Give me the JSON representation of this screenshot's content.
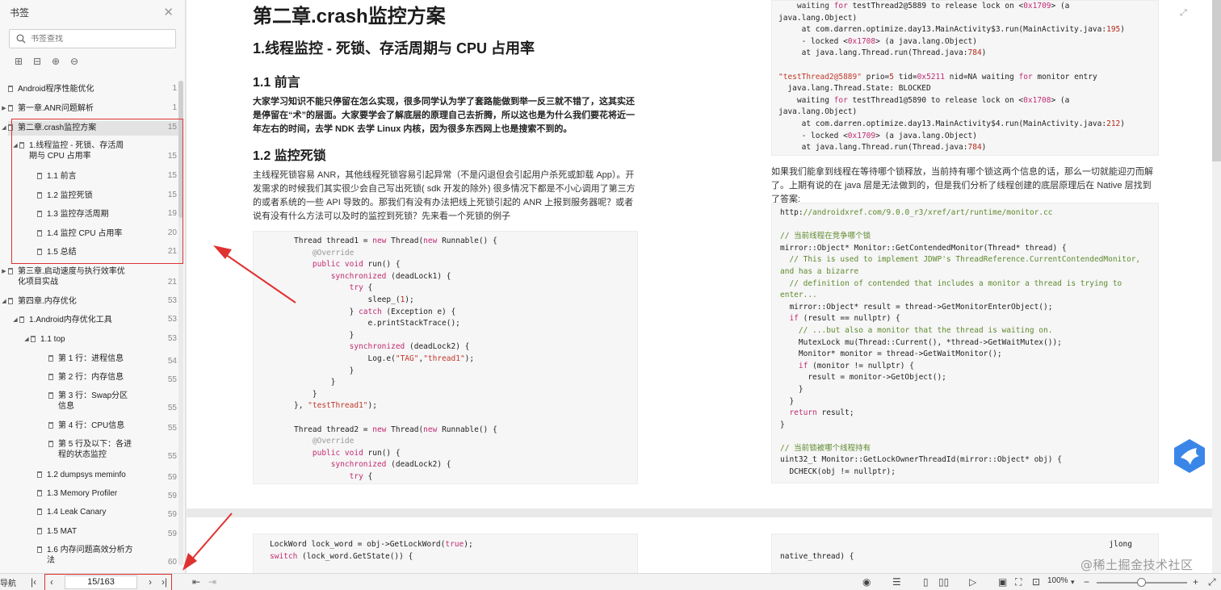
{
  "sidebar": {
    "title": "书签",
    "search_placeholder": "书签查找",
    "items": [
      {
        "label": "Android程序性能优化",
        "page": "1"
      },
      {
        "label": "第一章.ANR问题解析",
        "page": "1"
      },
      {
        "label": "第二章.crash监控方案",
        "page": "15"
      },
      {
        "label": "1.线程监控 - 死锁、存活周期与 CPU 占用率",
        "page": "15"
      },
      {
        "label": "1.1 前言",
        "page": "15"
      },
      {
        "label": "1.2 监控死锁",
        "page": "15"
      },
      {
        "label": "1.3 监控存活周期",
        "page": "19"
      },
      {
        "label": "1.4 监控 CPU 占用率",
        "page": "20"
      },
      {
        "label": "1.5 总结",
        "page": "21"
      },
      {
        "label": "第三章.启动速度与执行效率优化项目实战",
        "page": "21"
      },
      {
        "label": "第四章.内存优化",
        "page": "53"
      },
      {
        "label": "1.Android内存优化工具",
        "page": "53"
      },
      {
        "label": "1.1 top",
        "page": "53"
      },
      {
        "label": "第 1 行：进程信息",
        "page": "54"
      },
      {
        "label": "第 2 行：内存信息",
        "page": "55"
      },
      {
        "label": "第 3 行：Swap分区信息",
        "page": "55"
      },
      {
        "label": "第 4 行：CPU信息",
        "page": "55"
      },
      {
        "label": "第 5 行及以下：各进程的状态监控",
        "page": "55"
      },
      {
        "label": "1.2 dumpsys meminfo",
        "page": "59"
      },
      {
        "label": "1.3 Memory Profiler",
        "page": "59"
      },
      {
        "label": "1.4 Leak Canary",
        "page": "59"
      },
      {
        "label": "1.5 MAT",
        "page": "59"
      },
      {
        "label": "1.6 内存问题高效分析方法",
        "page": "60"
      }
    ]
  },
  "doc": {
    "h1": "第二章.crash监控方案",
    "h2": "1.线程监控 - 死锁、存活周期与 CPU 占用率",
    "h3_intro": "1.1 前言",
    "intro": "大家学习知识不能只停留在怎么实现，很多同学认为学了套路能做到举一反三就不错了，这其实还是停留在“术”的层面。大家要学会了解底层的原理自己去折腾，所以这也是为什么我们要花将近一年左右的时间，去学 NDK 去学 Linux 内核，因为很多东西网上也是搜索不到的。",
    "h3_deadlock": "1.2 监控死锁",
    "deadlock_para": "主线程死锁容易 ANR，其他线程死锁容易引起异常（不是闪退但会引起用户杀死或卸载 App）。开发需求的时候我们其实很少会自己写出死锁( sdk 开发的除外) 很多情况下都是不小心调用了第三方的或者系统的一些 API 导致的。那我们有没有办法把线上死锁引起的 ANR 上报到服务器呢？或者说有没有什么方法可以及时的监控到死锁？先来看一个死锁的例子",
    "right_para": "如果我们能拿到线程在等待哪个锁释放，当前持有哪个锁这两个信息的话，那么一切就能迎刃而解了。上期有说的在 java 层是无法做到的，但是我们分析了线程创建的底层原理后在 Native 层找到了答案:",
    "page2_right_tail": "jlong",
    "page2_right_line": "native_thread) {"
  },
  "status": {
    "nav_label": "导航",
    "page_indicator": "15/163",
    "zoom": "100%",
    "watermark": "@稀土掘金技术社区"
  },
  "colors": {
    "annotation_red": "#e03131",
    "keyword": "#c12a72",
    "string": "#c0392b"
  }
}
